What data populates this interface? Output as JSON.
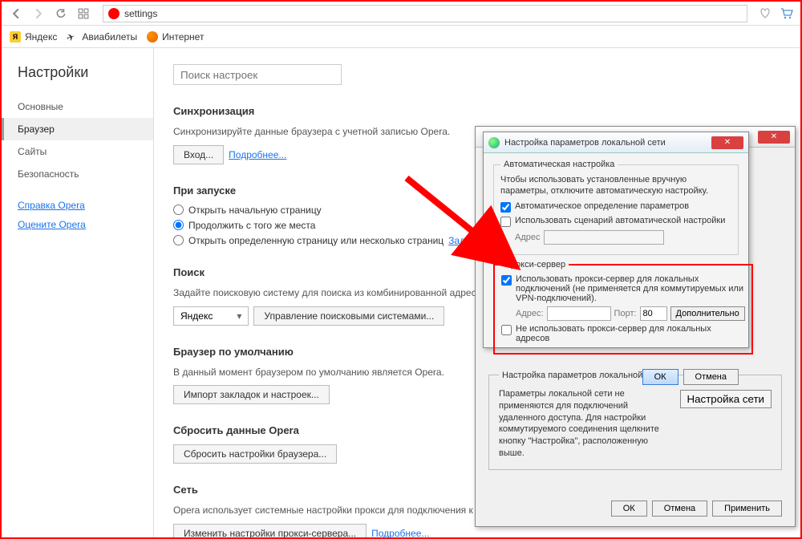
{
  "toolbar": {
    "url": "settings"
  },
  "bookmarks": {
    "yandex": "Яндекс",
    "avia": "Авиабилеты",
    "internet": "Интернет"
  },
  "sidebar": {
    "title": "Настройки",
    "items": [
      {
        "label": "Основные"
      },
      {
        "label": "Браузер"
      },
      {
        "label": "Сайты"
      },
      {
        "label": "Безопасность"
      }
    ],
    "help": "Справка Opera",
    "rate": "Оцените Opera"
  },
  "search": {
    "placeholder": "Поиск настроек"
  },
  "sections": {
    "sync": {
      "title": "Синхронизация",
      "desc": "Синхронизируйте данные браузера с учетной записью Opera.",
      "login": "Вход...",
      "more": "Подробнее..."
    },
    "startup": {
      "title": "При запуске",
      "opt1": "Открыть начальную страницу",
      "opt2": "Продолжить с того же места",
      "opt3": "Открыть определенную страницу или несколько страниц",
      "setpages": "Задать страницы"
    },
    "search_sec": {
      "title": "Поиск",
      "desc": "Задайте поисковую систему для поиска из комбинированной адресной строки",
      "selected": "Яндекс",
      "manage": "Управление поисковыми системами..."
    },
    "default_browser": {
      "title": "Браузер по умолчанию",
      "desc": "В данный момент браузером по умолчанию является Opera.",
      "import": "Импорт закладок и настроек..."
    },
    "reset": {
      "title": "Сбросить данные Opera",
      "btn": "Сбросить настройки браузера..."
    },
    "network": {
      "title": "Сеть",
      "desc": "Opera использует системные настройки прокси для подключения к сети.",
      "btn": "Изменить настройки прокси-сервера...",
      "more": "Подробнее..."
    }
  },
  "lan_dialog": {
    "title": "Настройка параметров локальной сети",
    "auto_group": "Автоматическая настройка",
    "auto_desc": "Чтобы использовать установленные вручную параметры, отключите автоматическую настройку.",
    "auto_detect": "Автоматическое определение параметров",
    "use_script": "Использовать сценарий автоматической настройки",
    "address_label": "Адрес",
    "proxy_group": "Прокси-сервер",
    "use_proxy": "Использовать прокси-сервер для локальных подключений (не применяется для коммутируемых или VPN-подключений).",
    "addr_label": "Адрес:",
    "addr_value": "",
    "port_label": "Порт:",
    "port_value": "80",
    "advanced": "Дополнительно",
    "bypass_local": "Не использовать прокси-сервер для локальных адресов",
    "ok": "ОК",
    "cancel": "Отмена"
  },
  "inet_dialog": {
    "lan_settings_group": "Настройка параметров локальной сети",
    "lan_desc": "Параметры локальной сети не применяются для подключений удаленного доступа. Для настройки коммутируемого соединения щелкните кнопку \"Настройка\", расположенную выше.",
    "lan_btn": "Настройка сети",
    "ok": "ОК",
    "cancel": "Отмена",
    "apply": "Применить"
  }
}
